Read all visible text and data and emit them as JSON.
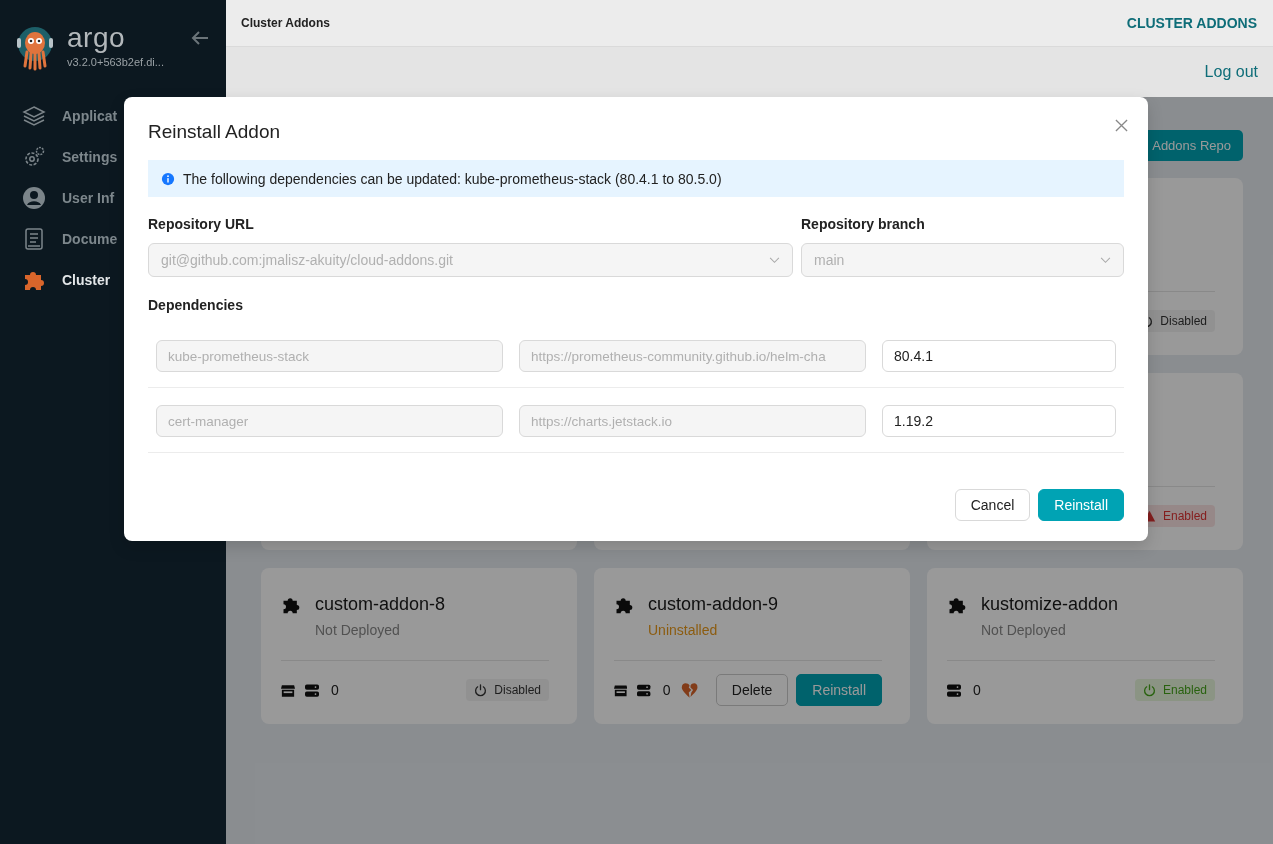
{
  "sidebar": {
    "brand": "argo",
    "version": "v3.2.0+563b2ef.di...",
    "items": [
      {
        "label": "Applicat",
        "selected": false
      },
      {
        "label": "Settings",
        "selected": false
      },
      {
        "label": "User Inf",
        "selected": false
      },
      {
        "label": "Docume",
        "selected": false
      },
      {
        "label": "Cluster",
        "selected": true
      }
    ]
  },
  "header": {
    "breadcrumb": "Cluster Addons",
    "title": "CLUSTER ADDONS",
    "logout": "Log out"
  },
  "toolbar": {
    "button": "Addons Repo"
  },
  "covered_cards": [
    {
      "toggle": {
        "kind": "disabled",
        "label": "Disabled"
      }
    },
    {
      "toggle": {
        "kind": "error",
        "label": "Enabled"
      }
    }
  ],
  "cards": [
    {
      "name": "custom-addon-8",
      "status": {
        "kind": "not-deployed",
        "label": "Not Deployed"
      },
      "source_icon": true,
      "count": "0",
      "unhealthy": false,
      "toggle": {
        "kind": "disabled",
        "label": "Disabled"
      }
    },
    {
      "name": "custom-addon-9",
      "status": {
        "kind": "uninstalled",
        "label": "Uninstalled"
      },
      "source_icon": true,
      "count": "0",
      "unhealthy": true,
      "actions": [
        "Delete",
        "Reinstall"
      ]
    },
    {
      "name": "kustomize-addon",
      "status": {
        "kind": "not-deployed",
        "label": "Not Deployed"
      },
      "source_icon": false,
      "count": "0",
      "unhealthy": false,
      "toggle": {
        "kind": "enabled",
        "label": "Enabled"
      }
    }
  ],
  "modal": {
    "title": "Reinstall Addon",
    "alert": "The following dependencies can be updated: kube-prometheus-stack (80.4.1 to 80.5.0)",
    "repo_url": {
      "label": "Repository URL",
      "value": "git@github.com:jmalisz-akuity/cloud-addons.git"
    },
    "repo_branch": {
      "label": "Repository branch",
      "value": "main"
    },
    "dependencies_label": "Dependencies",
    "dependencies": [
      {
        "name": "kube-prometheus-stack",
        "url": "https://prometheus-community.github.io/helm-cha",
        "version": "80.4.1"
      },
      {
        "name": "cert-manager",
        "url": "https://charts.jetstack.io",
        "version": "1.19.2"
      }
    ],
    "buttons": {
      "cancel": "Cancel",
      "confirm": "Reinstall"
    }
  }
}
